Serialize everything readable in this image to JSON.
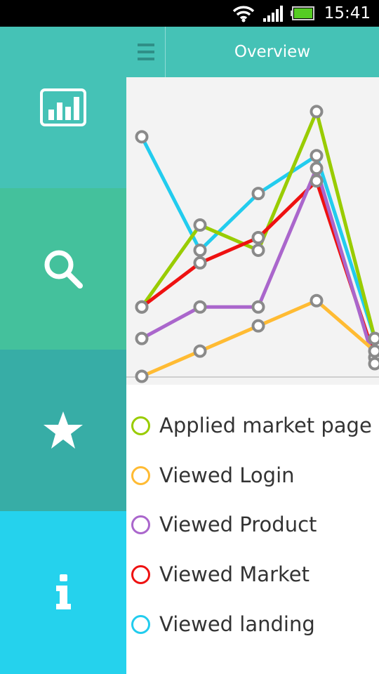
{
  "status_bar": {
    "time": "15:41",
    "icons": [
      "wifi-icon",
      "signal-icon",
      "battery-icon"
    ],
    "battery_color": "#55cc22"
  },
  "side_menu": {
    "items": [
      {
        "name": "menu-item-charts",
        "icon": "bar-chart-icon",
        "color": "#45c2b6"
      },
      {
        "name": "menu-item-search",
        "icon": "search-icon",
        "color": "#44c19c"
      },
      {
        "name": "menu-item-favorites",
        "icon": "star-icon",
        "color": "#37ada6"
      },
      {
        "name": "menu-item-info",
        "icon": "info-icon",
        "color": "#25d2ed"
      }
    ]
  },
  "header": {
    "title": "Overview",
    "menu_icon": "hamburger-icon",
    "background": "#45c2b6"
  },
  "legend": {
    "items": [
      {
        "label": "Applied market page F",
        "color": "#99cc00"
      },
      {
        "label": "Viewed Login",
        "color": "#ffbb33"
      },
      {
        "label": "Viewed Product",
        "color": "#aa66cc"
      },
      {
        "label": "Viewed Market",
        "color": "#ee1111"
      },
      {
        "label": "Viewed landing",
        "color": "#22ccee"
      }
    ]
  },
  "chart_data": {
    "type": "line",
    "x": [
      1,
      2,
      3,
      4,
      5
    ],
    "series": [
      {
        "name": "Viewed landing",
        "color": "#22ccee",
        "values": [
          38,
          20,
          29,
          35,
          6
        ]
      },
      {
        "name": "Applied market page F",
        "color": "#99cc00",
        "values": [
          11,
          24,
          20,
          42,
          6
        ]
      },
      {
        "name": "Viewed Market",
        "color": "#ee1111",
        "values": [
          11,
          18,
          22,
          31,
          3
        ]
      },
      {
        "name": "Viewed Product",
        "color": "#aa66cc",
        "values": [
          6,
          11,
          11,
          33,
          2
        ]
      },
      {
        "name": "Viewed Login",
        "color": "#ffbb33",
        "values": [
          0,
          4,
          8,
          12,
          4
        ]
      }
    ],
    "ylim": [
      0,
      45
    ],
    "grid": false
  }
}
